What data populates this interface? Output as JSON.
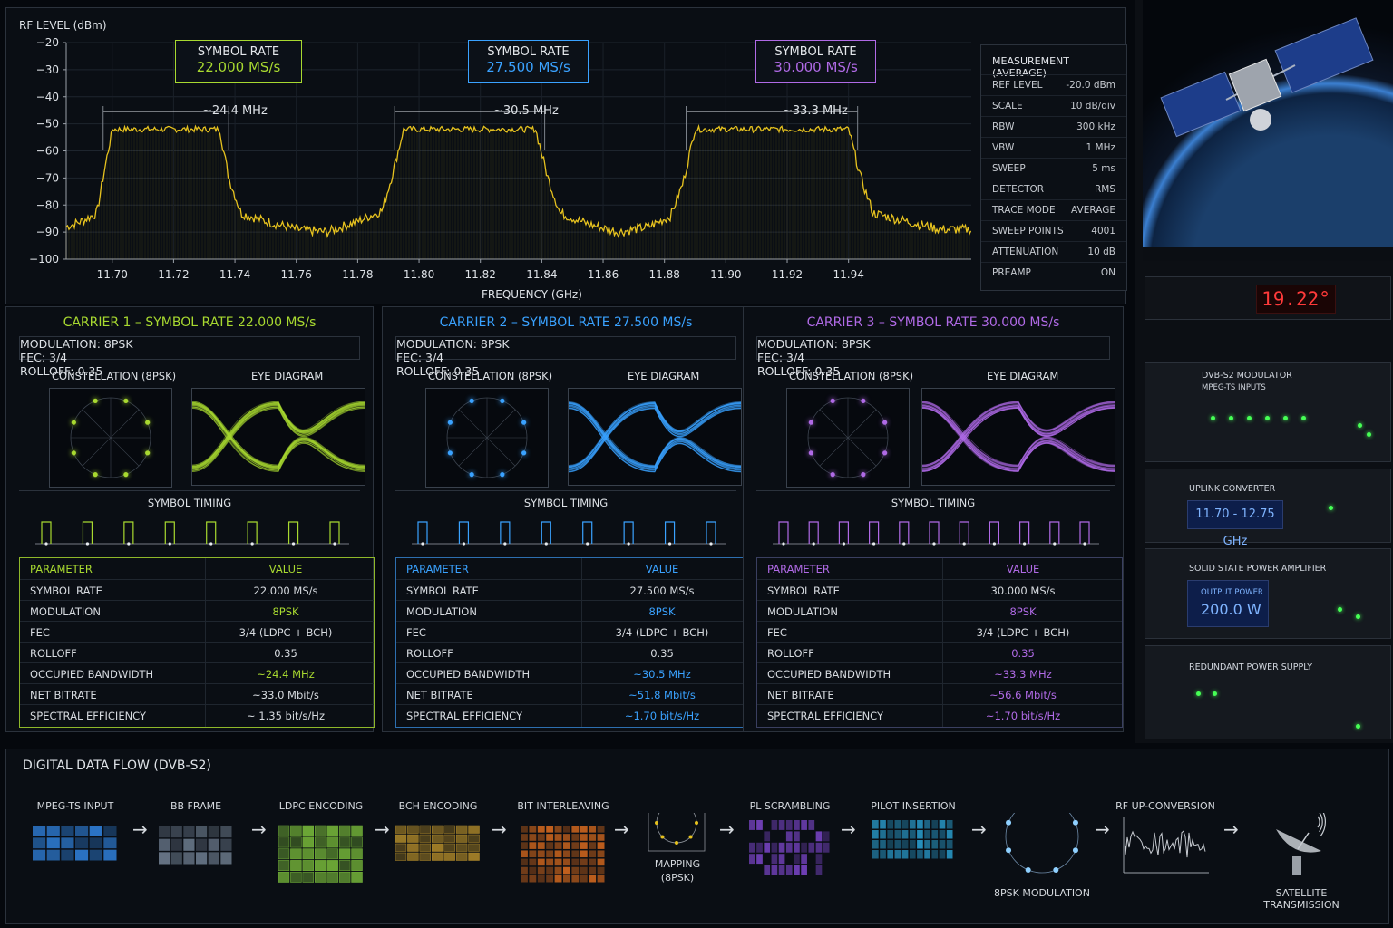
{
  "spectrum": {
    "y_label": "RF LEVEL (dBm)",
    "x_label": "FREQUENCY (GHz)",
    "y_ticks": [
      "−20",
      "−30",
      "−40",
      "−50",
      "−60",
      "−70",
      "−80",
      "−90",
      "−100"
    ],
    "x_ticks": [
      "11.70",
      "11.72",
      "11.74",
      "11.76",
      "11.78",
      "11.80",
      "11.82",
      "11.84",
      "11.86",
      "11.88",
      "11.90",
      "11.92",
      "11.94"
    ],
    "rate_boxes": [
      {
        "label": "SYMBOL RATE",
        "value": "22.000 MS/s",
        "bw": "~24.4 MHz",
        "color": "#a8d930"
      },
      {
        "label": "SYMBOL RATE",
        "value": "27.500 MS/s",
        "bw": "~30.5 MHz",
        "color": "#3aa2ff"
      },
      {
        "label": "SYMBOL RATE",
        "value": "30.000 MS/s",
        "bw": "~33.3 MHz",
        "color": "#b06ae6"
      }
    ]
  },
  "chart_data": {
    "type": "line",
    "xlabel": "FREQUENCY (GHz)",
    "ylabel": "RF LEVEL (dBm)",
    "xlim": [
      11.685,
      11.98
    ],
    "ylim": [
      -100,
      -20
    ],
    "grid": true,
    "trace_color": "#e6c21f",
    "series": [
      {
        "x": [
          11.685,
          11.69,
          11.695,
          11.697,
          11.7,
          11.735,
          11.738,
          11.742,
          11.75,
          11.76,
          11.77,
          11.78,
          11.788,
          11.791,
          11.795,
          11.838,
          11.842,
          11.846,
          11.855,
          11.865,
          11.875,
          11.882,
          11.886,
          11.89,
          11.94,
          11.944,
          11.948,
          11.955,
          11.97,
          11.978
        ],
        "y": [
          -88,
          -86,
          -83,
          -70,
          -52,
          -52,
          -70,
          -83,
          -86,
          -89,
          -90,
          -86,
          -82,
          -70,
          -52,
          -52,
          -70,
          -83,
          -87,
          -90,
          -88,
          -84,
          -72,
          -52,
          -52,
          -70,
          -83,
          -85,
          -89,
          -89
        ]
      }
    ]
  },
  "measurement": {
    "title": "MEASUREMENT (AVERAGE)",
    "rows": [
      {
        "k": "REF LEVEL",
        "v": "-20.0 dBm"
      },
      {
        "k": "SCALE",
        "v": "10 dB/div"
      },
      {
        "k": "RBW",
        "v": "300 kHz"
      },
      {
        "k": "VBW",
        "v": "1 MHz"
      },
      {
        "k": "SWEEP",
        "v": "5 ms"
      },
      {
        "k": "DETECTOR",
        "v": "RMS"
      },
      {
        "k": "TRACE MODE",
        "v": "AVERAGE"
      },
      {
        "k": "SWEEP POINTS",
        "v": "4001"
      },
      {
        "k": "ATTENUATION",
        "v": "10 dB"
      },
      {
        "k": "PREAMP",
        "v": "ON"
      }
    ]
  },
  "carriers": [
    {
      "title": "CARRIER 1 – SYMBOL RATE 22.000 MS/s",
      "color": "#a8d930",
      "modulation": "MODULATION:  8PSK",
      "fec": "FEC:  3/4",
      "rolloff": "ROLLOFF:  0.35",
      "constellation": "CONSTELLATION (8PSK)",
      "eye": "EYE DIAGRAM",
      "timing": "SYMBOL TIMING",
      "th_param": "PARAMETER",
      "th_value": "VALUE",
      "rows": [
        {
          "k": "SYMBOL RATE",
          "v": "22.000 MS/s"
        },
        {
          "k": "MODULATION",
          "v": "8PSK"
        },
        {
          "k": "FEC",
          "v": "3/4 (LDPC + BCH)"
        },
        {
          "k": "ROLLOFF",
          "v": "0.35"
        },
        {
          "k": "OCCUPIED BANDWIDTH",
          "v": "~24.4 MHz"
        },
        {
          "k": "NET BITRATE",
          "v": "~33.0 Mbit/s"
        },
        {
          "k": "SPECTRAL EFFICIENCY",
          "v": "~ 1.35 bit/s/Hz"
        }
      ]
    },
    {
      "title": "CARRIER 2 – SYMBOL RATE 27.500 MS/s",
      "color": "#3aa2ff",
      "modulation": "MODULATION:  8PSK",
      "fec": "FEC:  3/4",
      "rolloff": "ROLLOFF:  0.35",
      "constellation": "CONSTELLATION (8PSK)",
      "eye": "EYE DIAGRAM",
      "timing": "SYMBOL TIMING",
      "th_param": "PARAMETER",
      "th_value": "VALUE",
      "rows": [
        {
          "k": "SYMBOL RATE",
          "v": "27.500 MS/s"
        },
        {
          "k": "MODULATION",
          "v": "8PSK"
        },
        {
          "k": "FEC",
          "v": "3/4 (LDPC + BCH)"
        },
        {
          "k": "ROLLOFF",
          "v": "0.35"
        },
        {
          "k": "OCCUPIED BANDWIDTH",
          "v": "~30.5 MHz"
        },
        {
          "k": "NET BITRATE",
          "v": "~51.8 Mbit/s"
        },
        {
          "k": "SPECTRAL EFFICIENCY",
          "v": "~1.70 bit/s/Hz"
        }
      ]
    },
    {
      "title": "CARRIER 3 – SYMBOL RATE 30.000 MS/s",
      "color": "#b06ae6",
      "modulation": "MODULATION:  8PSK",
      "fec": "FEC:  3/4",
      "rolloff": "ROLLOFF:  0.35",
      "constellation": "CONSTELLATION (8PSK)",
      "eye": "EYE DIAGRAM",
      "timing": "SYMBOL TIMING",
      "th_param": "PARAMETER",
      "th_value": "VALUE",
      "rows": [
        {
          "k": "SYMBOL RATE",
          "v": "30.000 MS/s"
        },
        {
          "k": "MODULATION",
          "v": "8PSK"
        },
        {
          "k": "FEC",
          "v": "3/4 (LDPC + BCH)"
        },
        {
          "k": "ROLLOFF",
          "v": "0.35"
        },
        {
          "k": "OCCUPIED BANDWIDTH",
          "v": "~33.3 MHz"
        },
        {
          "k": "NET BITRATE",
          "v": "~56.6 Mbit/s"
        },
        {
          "k": "SPECTRAL EFFICIENCY",
          "v": "~1.70 bit/s/Hz"
        }
      ]
    }
  ],
  "rack": {
    "temp": "19.22°",
    "modulator_title": "DVB-S2 MODULATOR",
    "modulator_sub": "MPEG-TS INPUTS",
    "upconv_title": "UPLINK CONVERTER",
    "upconv_value": "11.70 - 12.75 GHz",
    "ampl_title": "SOLID STATE POWER AMPLIFIER",
    "ampl_label": "OUTPUT POWER",
    "ampl_value": "200.0 W",
    "psu_title": "REDUNDANT POWER SUPPLY"
  },
  "flow": {
    "title": "DIGITAL DATA FLOW (DVB-S2)",
    "steps": [
      {
        "label": "MPEG-TS INPUT",
        "icon": "mpeg-ts-blocks-icon",
        "color": "#2f7fd9"
      },
      {
        "label": "BB FRAME",
        "icon": "bb-frame-grid-icon",
        "color": "#6f7e90"
      },
      {
        "label": "LDPC ENCODING",
        "icon": "ldpc-matrix-icon",
        "color": "#77b83a"
      },
      {
        "label": "BCH ENCODING",
        "icon": "bch-grid-icon",
        "color": "#b08a2a"
      },
      {
        "label": "BIT INTERLEAVING",
        "icon": "interleave-grid-icon",
        "color": "#d86a1e"
      },
      {
        "label": "MAPPING",
        "sublabel": "(8PSK)",
        "icon": "mapping-icon",
        "color": "#e6c21f"
      },
      {
        "label": "PL SCRAMBLING",
        "icon": "scramble-grid-icon",
        "color": "#7a45c8"
      },
      {
        "label": "PILOT INSERTION",
        "icon": "pilot-grid-icon",
        "color": "#2a9fd0"
      },
      {
        "label": "8PSK MODULATION",
        "icon": "constellation-icon",
        "color": "#8fd0ff"
      },
      {
        "label": "RF UP-CONVERSION",
        "icon": "rf-waveform-icon",
        "color": "#c8ccd2"
      },
      {
        "label": "SATELLITE TRANSMISSION",
        "icon": "satellite-dish-icon",
        "color": "#c8ccd2"
      }
    ]
  }
}
